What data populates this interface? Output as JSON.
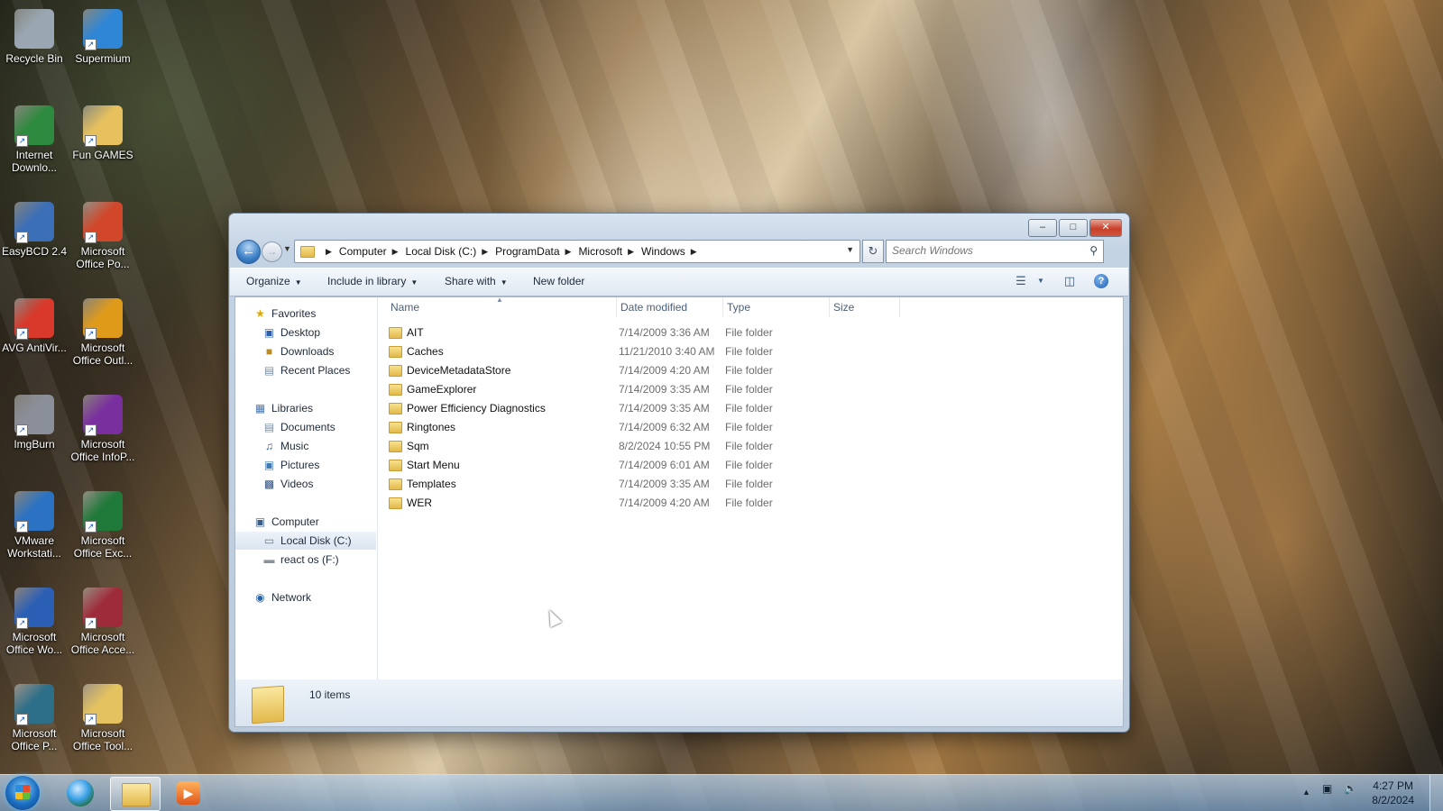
{
  "desktop": {
    "icons": [
      {
        "label": "Recycle Bin",
        "icon": "recycle-bin-icon"
      },
      {
        "label": "Supermium",
        "icon": "supermium-browser-icon"
      },
      {
        "label": "Internet Downlo...",
        "icon": "internet-download-manager-icon"
      },
      {
        "label": "Fun GAMES",
        "icon": "folder-icon"
      },
      {
        "label": "EasyBCD 2.4",
        "icon": "easybcd-icon"
      },
      {
        "label": "Microsoft Office Po...",
        "icon": "powerpoint-icon"
      },
      {
        "label": "AVG AntiVir...",
        "icon": "avg-antivirus-icon"
      },
      {
        "label": "Microsoft Office Outl...",
        "icon": "outlook-icon"
      },
      {
        "label": "ImgBurn",
        "icon": "imgburn-icon"
      },
      {
        "label": "Microsoft Office InfoP...",
        "icon": "infopath-icon"
      },
      {
        "label": "VMware Workstati...",
        "icon": "vmware-icon"
      },
      {
        "label": "Microsoft Office Exc...",
        "icon": "excel-icon"
      },
      {
        "label": "Microsoft Office Wo...",
        "icon": "word-icon"
      },
      {
        "label": "Microsoft Office Acce...",
        "icon": "access-icon"
      },
      {
        "label": "Microsoft Office P...",
        "icon": "publisher-icon"
      },
      {
        "label": "Microsoft Office Tool...",
        "icon": "office-tools-folder-icon"
      }
    ]
  },
  "window": {
    "breadcrumb": [
      "Computer",
      "Local Disk (C:)",
      "ProgramData",
      "Microsoft",
      "Windows"
    ],
    "search_placeholder": "Search Windows",
    "toolbar": {
      "organize": "Organize",
      "include_in_library": "Include in library",
      "share_with": "Share with",
      "new_folder": "New folder"
    },
    "nav": {
      "favorites": "Favorites",
      "desktop": "Desktop",
      "downloads": "Downloads",
      "recent_places": "Recent Places",
      "libraries": "Libraries",
      "documents": "Documents",
      "music": "Music",
      "pictures": "Pictures",
      "videos": "Videos",
      "computer": "Computer",
      "local_disk": "Local Disk (C:)",
      "react_os": "react os (F:)",
      "network": "Network"
    },
    "columns": {
      "name": "Name",
      "date_modified": "Date modified",
      "type": "Type",
      "size": "Size"
    },
    "files": [
      {
        "name": "AIT",
        "date": "7/14/2009 3:36 AM",
        "type": "File folder"
      },
      {
        "name": "Caches",
        "date": "11/21/2010 3:40 AM",
        "type": "File folder"
      },
      {
        "name": "DeviceMetadataStore",
        "date": "7/14/2009 4:20 AM",
        "type": "File folder"
      },
      {
        "name": "GameExplorer",
        "date": "7/14/2009 3:35 AM",
        "type": "File folder"
      },
      {
        "name": "Power Efficiency Diagnostics",
        "date": "7/14/2009 3:35 AM",
        "type": "File folder"
      },
      {
        "name": "Ringtones",
        "date": "7/14/2009 6:32 AM",
        "type": "File folder"
      },
      {
        "name": "Sqm",
        "date": "8/2/2024 10:55 PM",
        "type": "File folder"
      },
      {
        "name": "Start Menu",
        "date": "7/14/2009 6:01 AM",
        "type": "File folder"
      },
      {
        "name": "Templates",
        "date": "7/14/2009 3:35 AM",
        "type": "File folder"
      },
      {
        "name": "WER",
        "date": "7/14/2009 4:20 AM",
        "type": "File folder"
      }
    ],
    "status": "10 items"
  },
  "taskbar": {
    "time": "4:27 PM",
    "date": "8/2/2024"
  }
}
